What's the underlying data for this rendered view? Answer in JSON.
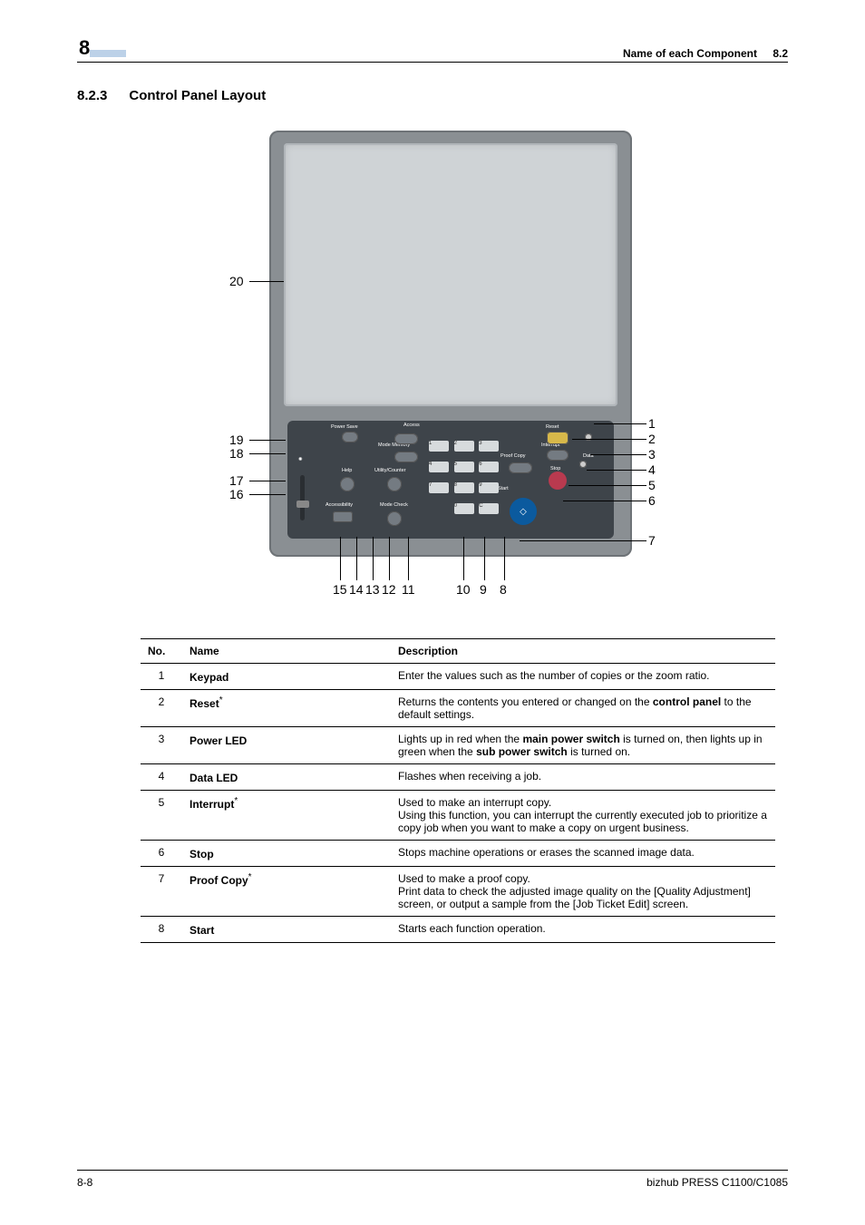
{
  "header": {
    "chapter_number": "8",
    "right_title": "Name of each Component",
    "right_section": "8.2"
  },
  "section": {
    "number": "8.2.3",
    "title": "Control Panel Layout"
  },
  "panel": {
    "labels": {
      "power_save": "Power Save",
      "access": "Access",
      "reset": "Reset",
      "mode_memory": "Mode Memory",
      "proof_copy": "Proof Copy",
      "interrupt": "Interrupt",
      "data": "Data",
      "help": "Help",
      "utility_counter": "Utility/Counter",
      "stop": "Stop",
      "accessibility": "Accessibility",
      "mode_check": "Mode Check",
      "start": "Start"
    },
    "keypad": {
      "k1": "1",
      "k2": "2",
      "k3": "3",
      "k4": "4",
      "k5": "5",
      "k6": "6",
      "k7": "7",
      "k8": "8",
      "k9": "9",
      "k0": "0",
      "kc": "C"
    },
    "callouts": {
      "c1": "1",
      "c2": "2",
      "c3": "3",
      "c4": "4",
      "c5": "5",
      "c6": "6",
      "c7": "7",
      "c8": "8",
      "c9": "9",
      "c10": "10",
      "c11": "11",
      "c12": "12",
      "c13": "13",
      "c14": "14",
      "c15": "15",
      "c16": "16",
      "c17": "17",
      "c18": "18",
      "c19": "19",
      "c20": "20"
    }
  },
  "table": {
    "headers": {
      "no": "No.",
      "name": "Name",
      "desc": "Description"
    },
    "rows": [
      {
        "no": "1",
        "name": "Keypad",
        "name_star": "",
        "desc_pre": "Enter the values such as the number of copies or the zoom ratio.",
        "desc_bold1": "",
        "desc_mid": "",
        "desc_bold2": "",
        "desc_post": ""
      },
      {
        "no": "2",
        "name": "Reset",
        "name_star": "*",
        "desc_pre": "Returns the contents you entered or changed on the ",
        "desc_bold1": "control panel",
        "desc_mid": " to the default settings.",
        "desc_bold2": "",
        "desc_post": ""
      },
      {
        "no": "3",
        "name": "Power LED",
        "name_star": "",
        "desc_pre": "Lights up in red when the ",
        "desc_bold1": "main power switch",
        "desc_mid": " is turned on, then lights up in green when the ",
        "desc_bold2": "sub power switch",
        "desc_post": " is turned on."
      },
      {
        "no": "4",
        "name": "Data LED",
        "name_star": "",
        "desc_pre": "Flashes when receiving a job.",
        "desc_bold1": "",
        "desc_mid": "",
        "desc_bold2": "",
        "desc_post": ""
      },
      {
        "no": "5",
        "name": "Interrupt",
        "name_star": "*",
        "desc_pre": "Used to make an interrupt copy.\nUsing this function, you can interrupt the currently executed job to prioritize a copy job when you want to make a copy on urgent business.",
        "desc_bold1": "",
        "desc_mid": "",
        "desc_bold2": "",
        "desc_post": ""
      },
      {
        "no": "6",
        "name": "Stop",
        "name_star": "",
        "desc_pre": "Stops machine operations or erases the scanned image data.",
        "desc_bold1": "",
        "desc_mid": "",
        "desc_bold2": "",
        "desc_post": ""
      },
      {
        "no": "7",
        "name": "Proof Copy",
        "name_star": "*",
        "desc_pre": "Used to make a proof copy.\nPrint data to check the adjusted image quality on the [Quality Adjustment] screen, or output a sample from the [Job Ticket Edit] screen.",
        "desc_bold1": "",
        "desc_mid": "",
        "desc_bold2": "",
        "desc_post": ""
      },
      {
        "no": "8",
        "name": "Start",
        "name_star": "",
        "desc_pre": "Starts each function operation.",
        "desc_bold1": "",
        "desc_mid": "",
        "desc_bold2": "",
        "desc_post": ""
      }
    ]
  },
  "footer": {
    "page": "8-8",
    "model": "bizhub PRESS C1100/C1085"
  }
}
